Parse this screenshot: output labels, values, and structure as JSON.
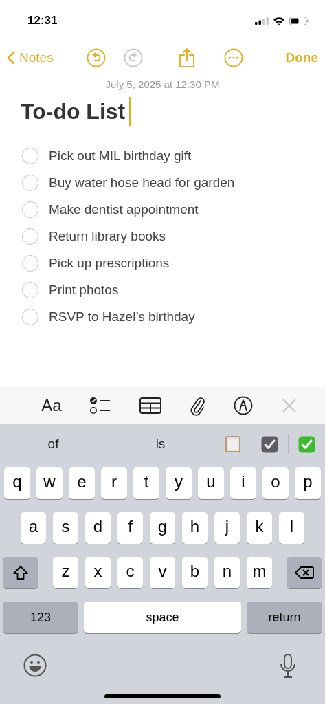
{
  "status_bar": {
    "time": "12:31"
  },
  "nav": {
    "back": "Notes",
    "undo": {
      "disabled": false
    },
    "redo": {
      "disabled": true
    },
    "done": "Done"
  },
  "note": {
    "date": "July 5, 2025 at 12:30 PM",
    "title": "To-do List",
    "items": [
      {
        "text": "Pick out MIL birthday gift",
        "checked": false
      },
      {
        "text": "Buy water hose head for garden",
        "checked": false
      },
      {
        "text": "Make dentist appointment",
        "checked": false
      },
      {
        "text": "Return library books",
        "checked": false
      },
      {
        "text": "Pick up prescriptions",
        "checked": false
      },
      {
        "text": "Print photos",
        "checked": false
      },
      {
        "text": "RSVP to Hazel’s birthday",
        "checked": false
      }
    ]
  },
  "format_toolbar": {
    "text_style": "Aa"
  },
  "keyboard": {
    "suggestions": [
      "of",
      "is"
    ],
    "rows": [
      {
        "keys": [
          {
            "kind": "letter",
            "label": "q"
          },
          {
            "kind": "letter",
            "label": "w"
          },
          {
            "kind": "letter",
            "label": "e"
          },
          {
            "kind": "letter",
            "label": "r"
          },
          {
            "kind": "letter",
            "label": "t"
          },
          {
            "kind": "letter",
            "label": "y"
          },
          {
            "kind": "letter",
            "label": "u"
          },
          {
            "kind": "letter",
            "label": "i"
          },
          {
            "kind": "letter",
            "label": "o"
          },
          {
            "kind": "letter",
            "label": "p"
          }
        ]
      },
      {
        "keys": [
          {
            "kind": "letter",
            "label": "a"
          },
          {
            "kind": "letter",
            "label": "s"
          },
          {
            "kind": "letter",
            "label": "d"
          },
          {
            "kind": "letter",
            "label": "f"
          },
          {
            "kind": "letter",
            "label": "g"
          },
          {
            "kind": "letter",
            "label": "h"
          },
          {
            "kind": "letter",
            "label": "j"
          },
          {
            "kind": "letter",
            "label": "k"
          },
          {
            "kind": "letter",
            "label": "l"
          }
        ]
      },
      {
        "keys": [
          {
            "kind": "shift"
          },
          {
            "kind": "letter",
            "label": "z"
          },
          {
            "kind": "letter",
            "label": "x"
          },
          {
            "kind": "letter",
            "label": "c"
          },
          {
            "kind": "letter",
            "label": "v"
          },
          {
            "kind": "letter",
            "label": "b"
          },
          {
            "kind": "letter",
            "label": "n"
          },
          {
            "kind": "letter",
            "label": "m"
          },
          {
            "kind": "delete"
          }
        ]
      },
      {
        "keys": [
          {
            "kind": "mode",
            "label": "123"
          },
          {
            "kind": "space",
            "label": "space"
          },
          {
            "kind": "return",
            "label": "return"
          }
        ]
      }
    ]
  }
}
